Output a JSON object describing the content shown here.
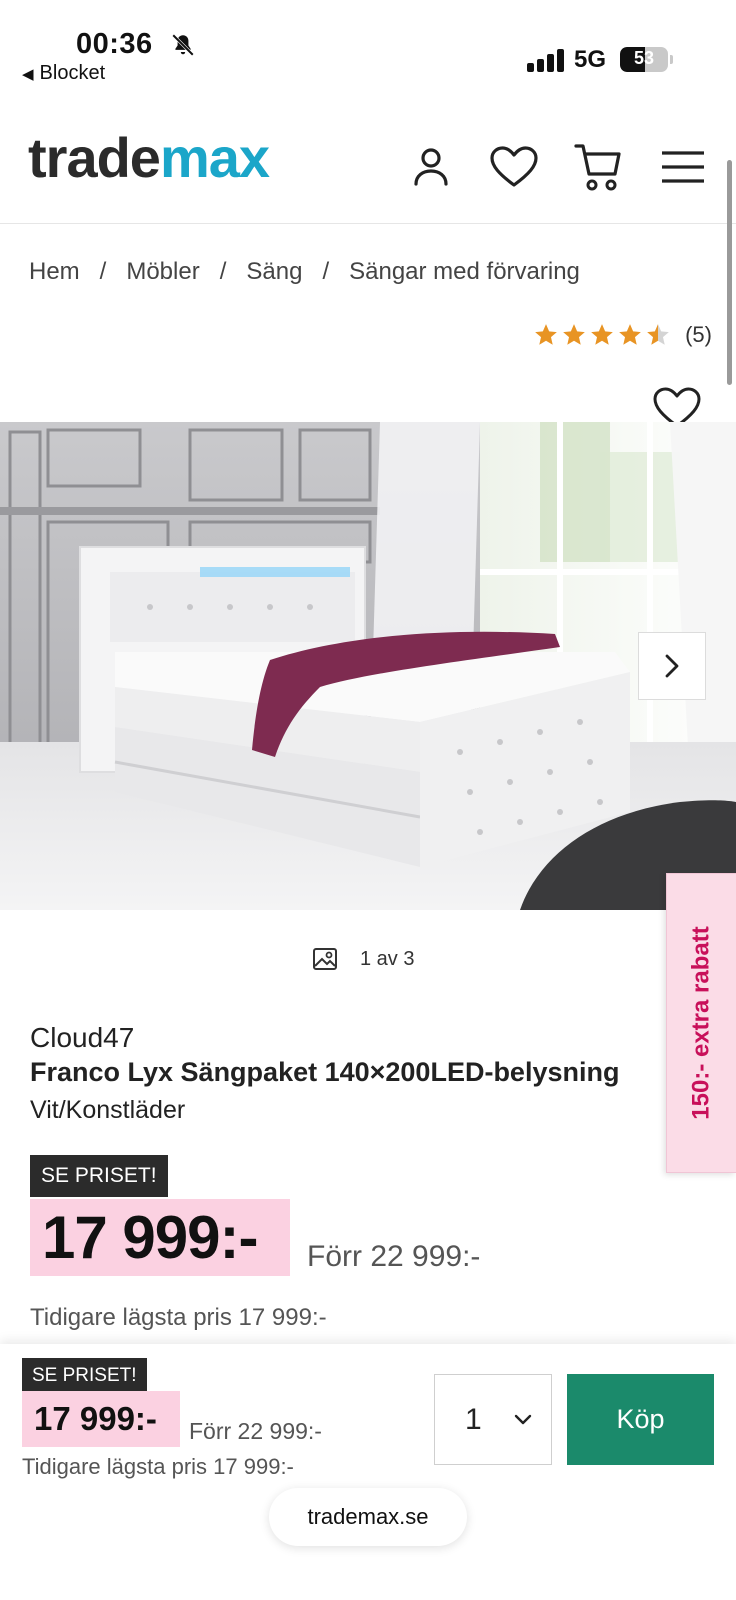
{
  "status_bar": {
    "time": "00:36",
    "back_label": "Blocket",
    "network": "5G",
    "battery": "53",
    "battery_level": 0.53
  },
  "header": {
    "logo_part1": "trade",
    "logo_part2": "max",
    "icons": [
      "account-icon",
      "heart-icon",
      "cart-icon",
      "menu-icon"
    ]
  },
  "breadcrumb": [
    "Hem",
    "Möbler",
    "Säng",
    "Sängar med förvaring"
  ],
  "rating": {
    "value": 4.5,
    "max": 5,
    "count": "(5)"
  },
  "gallery": {
    "counter": "1 av 3"
  },
  "promo_tab": "150:- extra rabatt",
  "product": {
    "brand": "Cloud47",
    "title": "Franco Lyx Sängpaket 140×200LED-belysning",
    "variant": "Vit/Konstläder",
    "badge": "SE PRISET!",
    "price": "17 999:-",
    "old_price": "Förr 22 999:-",
    "lowest_price": "Tidigare lägsta pris 17 999:-"
  },
  "sticky_bar": {
    "badge": "SE PRISET!",
    "price": "17 999:-",
    "old_price": "Förr 22 999:-",
    "lowest_price": "Tidigare lägsta pris 17 999:-",
    "quantity": "1",
    "buy_label": "Köp"
  },
  "url": "trademax.se",
  "colors": {
    "accent_blue": "#1ba6c9",
    "price_pink": "#fbd1e1",
    "buy_green": "#1b8a6b",
    "promo_pink": "#c8105a",
    "star_orange": "#e89424"
  }
}
